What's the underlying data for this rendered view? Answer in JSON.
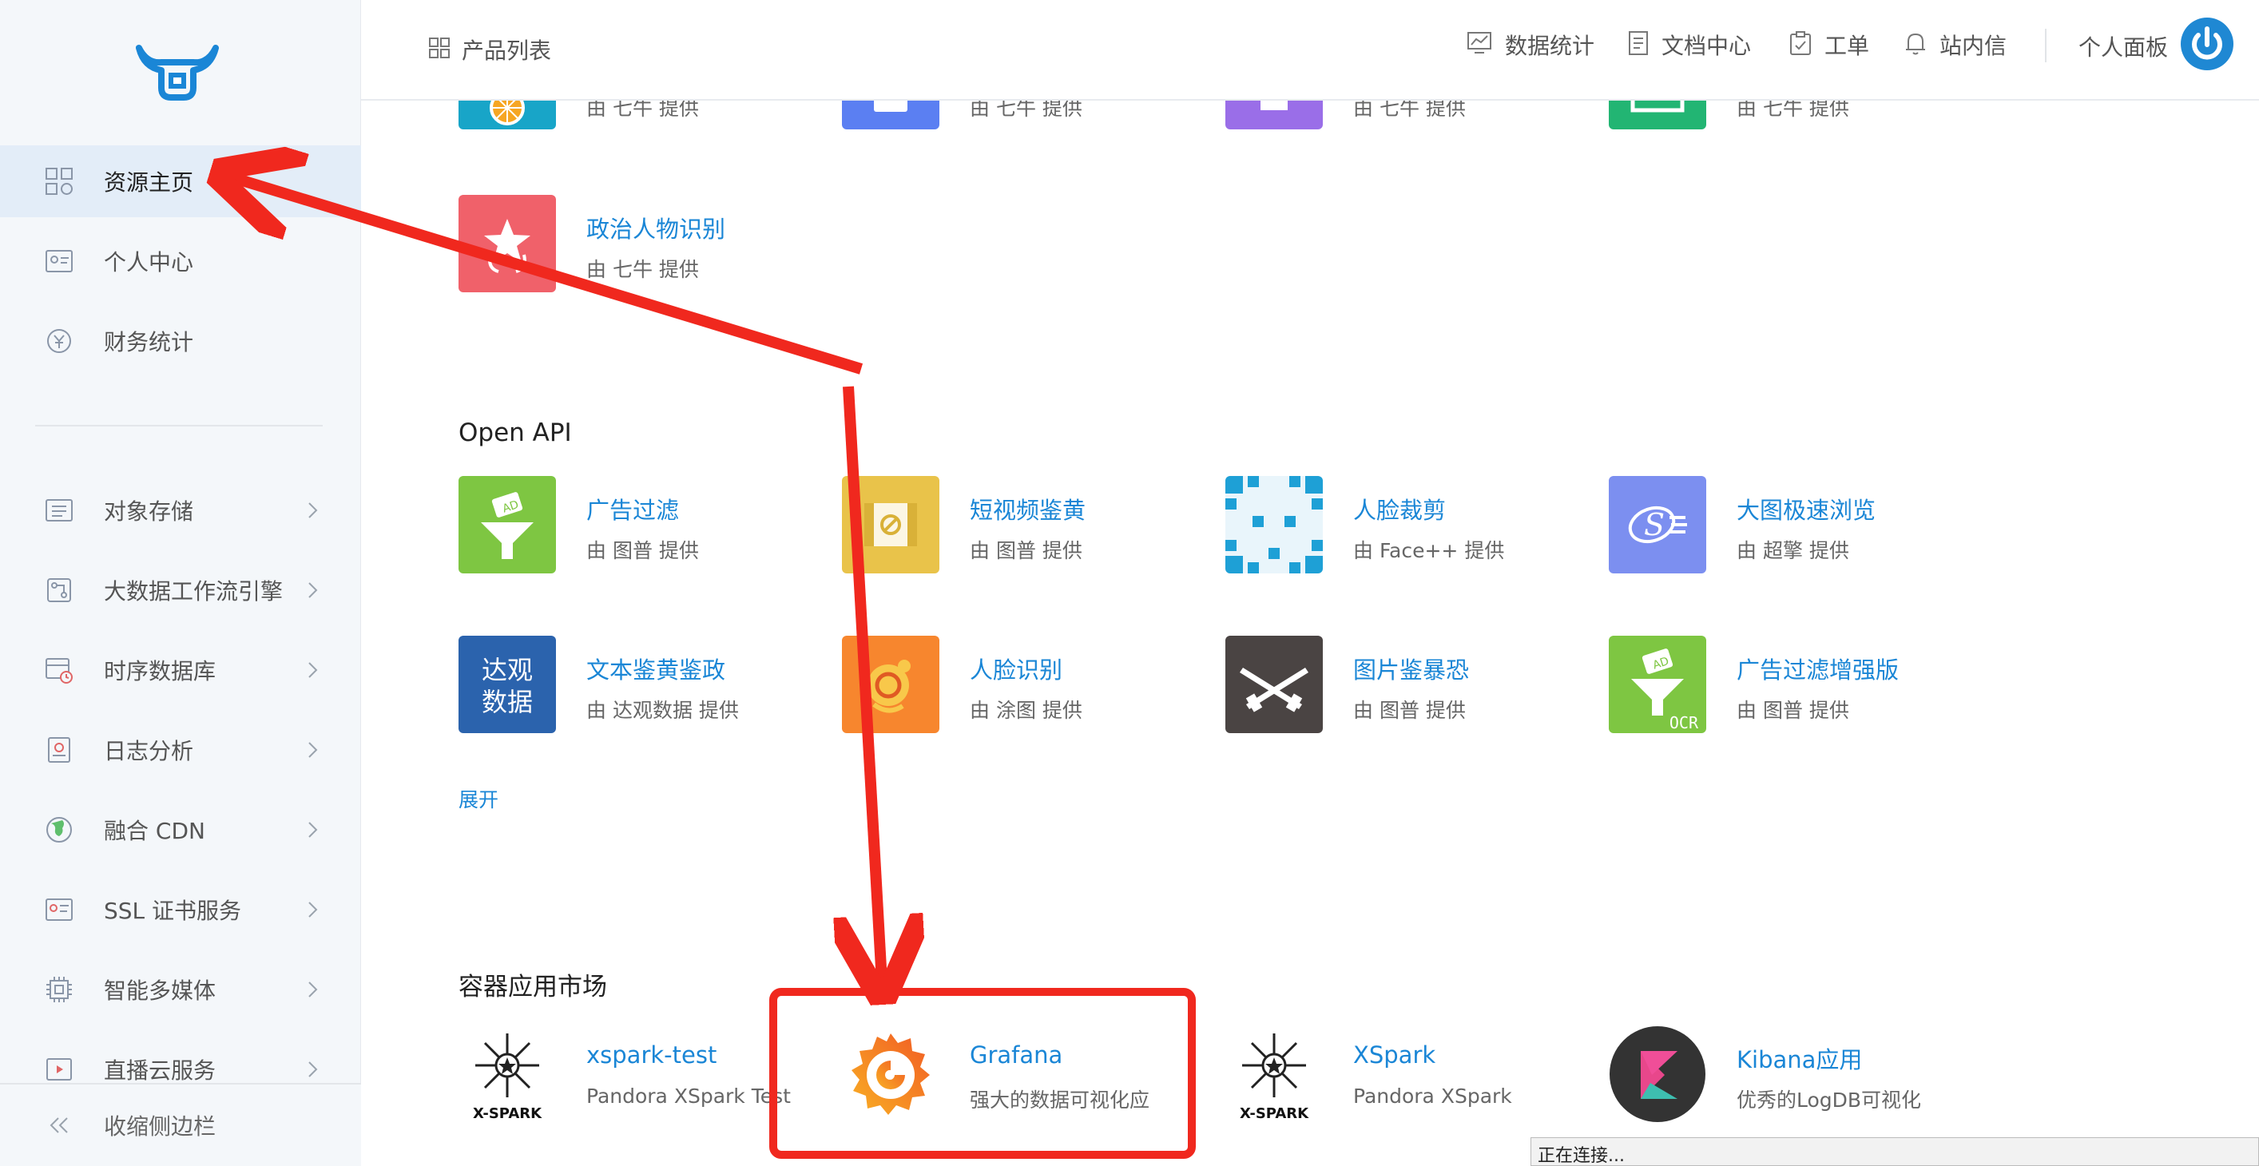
{
  "sidebar": {
    "primary": [
      {
        "label": "资源主页",
        "icon": "grid-icon",
        "active": true
      },
      {
        "label": "个人中心",
        "icon": "id-card-icon"
      },
      {
        "label": "财务统计",
        "icon": "finance-icon"
      }
    ],
    "services": [
      {
        "label": "对象存储",
        "icon": "storage-icon"
      },
      {
        "label": "大数据工作流引擎",
        "icon": "workflow-icon"
      },
      {
        "label": "时序数据库",
        "icon": "database-icon"
      },
      {
        "label": "日志分析",
        "icon": "log-icon"
      },
      {
        "label": "融合 CDN",
        "icon": "globe-icon"
      },
      {
        "label": "SSL 证书服务",
        "icon": "certificate-icon"
      },
      {
        "label": "智能多媒体",
        "icon": "chip-icon"
      },
      {
        "label": "直播云服务",
        "icon": "live-icon"
      }
    ],
    "collapse_label": "收缩侧边栏"
  },
  "topbar": {
    "breadcrumb": "产品列表",
    "nav": [
      {
        "label": "数据统计",
        "icon": "chart-icon"
      },
      {
        "label": "文档中心",
        "icon": "document-icon"
      },
      {
        "label": "工单",
        "icon": "clipboard-icon"
      },
      {
        "label": "站内信",
        "icon": "bell-icon"
      }
    ],
    "panel_label": "个人面板"
  },
  "top_row": [
    {
      "provider": "由 七牛 提供",
      "color": "#18a5c8"
    },
    {
      "provider": "由 七牛 提供",
      "color": "#5b7ff2"
    },
    {
      "provider": "由 七牛 提供",
      "color": "#9a6ee8"
    },
    {
      "provider": "由 七牛 提供",
      "color": "#22b573"
    }
  ],
  "qiniu_extra": {
    "name": "政治人物识别",
    "provider": "由 七牛 提供",
    "color": "#f0616a"
  },
  "open_api": {
    "title": "Open API",
    "items": [
      {
        "name": "广告过滤",
        "provider": "由 图普 提供",
        "color": "#7ec642"
      },
      {
        "name": "短视频鉴黄",
        "provider": "由 图普 提供",
        "color": "#e9c34a"
      },
      {
        "name": "人脸裁剪",
        "provider": "由 Face++ 提供",
        "color": "#1ea0d6"
      },
      {
        "name": "大图极速浏览",
        "provider": "由 超擎 提供",
        "color": "#7c8ff0"
      },
      {
        "name": "文本鉴黄鉴政",
        "provider": "由 达观数据 提供",
        "color": "#2b63ad",
        "logo_text": [
          "达观",
          "数据"
        ]
      },
      {
        "name": "人脸识别",
        "provider": "由 涂图 提供",
        "color": "#f7862e"
      },
      {
        "name": "图片鉴暴恐",
        "provider": "由 图普 提供",
        "color": "#4a4443"
      },
      {
        "name": "广告过滤增强版",
        "provider": "由 图普 提供",
        "color": "#7ec642",
        "logo_text": [
          "OCR"
        ]
      }
    ],
    "expand_label": "展开"
  },
  "market": {
    "title": "容器应用市场",
    "items": [
      {
        "name": "xspark-test",
        "desc": "Pandora XSpark Test",
        "logo_text": "X-SPARK"
      },
      {
        "name": "Grafana",
        "desc": "强大的数据可视化应"
      },
      {
        "name": "XSpark",
        "desc": "Pandora XSpark",
        "logo_text": "X-SPARK"
      },
      {
        "name": "Kibana应用",
        "desc": "优秀的LogDB可视化"
      }
    ]
  },
  "status_bar": "正在连接...",
  "annotation_color": "#f0281e"
}
